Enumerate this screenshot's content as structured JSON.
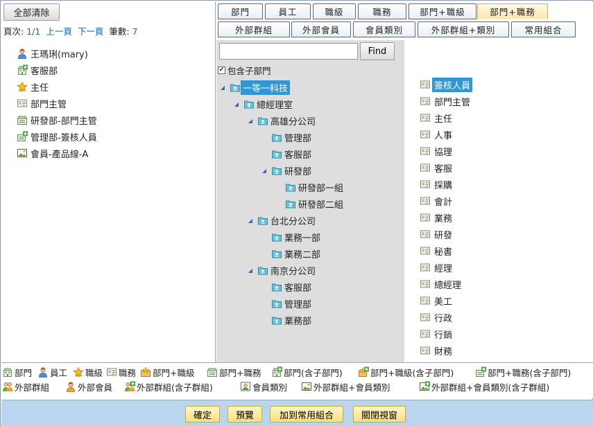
{
  "left": {
    "clear_label": "全部清除",
    "pager": {
      "page_label": "頁次:",
      "page_value": "1/1",
      "prev": "上一頁",
      "next": "下一頁",
      "count_label": "筆數:",
      "count_value": "7"
    },
    "selected": [
      {
        "label": "王瑪琍(mary)",
        "icon": "person-icon"
      },
      {
        "label": "客服部",
        "icon": "department-sub-icon"
      },
      {
        "label": "主任",
        "icon": "job-level-icon"
      },
      {
        "label": "部門主管",
        "icon": "job-title-icon"
      },
      {
        "label": "研發部-部門主管",
        "icon": "dept-job-title-icon"
      },
      {
        "label": "管理部-簽核人員",
        "icon": "dept-job-title-sub-icon"
      },
      {
        "label": "會員-產品線-A",
        "icon": "member-group-icon"
      }
    ]
  },
  "tabs": {
    "row1": [
      "部門",
      "員工",
      "職級",
      "職務",
      "部門+職級",
      "部門+職務"
    ],
    "row2": [
      "外部群組",
      "外部會員",
      "會員類別",
      "外部群組+類別",
      "常用組合"
    ],
    "active": "部門+職務"
  },
  "search": {
    "value": "",
    "placeholder": "",
    "find_label": "Find",
    "include_sub_label": "包含子部門",
    "include_sub_checked": true
  },
  "tree": [
    {
      "label": "一等一科技",
      "depth": 0,
      "toggle": "expanded",
      "selected": true
    },
    {
      "label": "總經理室",
      "depth": 1,
      "toggle": "expanded"
    },
    {
      "label": "高雄分公司",
      "depth": 2,
      "toggle": "expanded"
    },
    {
      "label": "管理部",
      "depth": 3,
      "toggle": "none"
    },
    {
      "label": "客服部",
      "depth": 3,
      "toggle": "none"
    },
    {
      "label": "研發部",
      "depth": 3,
      "toggle": "expanded"
    },
    {
      "label": "研發部一組",
      "depth": 4,
      "toggle": "none"
    },
    {
      "label": "研發部二組",
      "depth": 4,
      "toggle": "none"
    },
    {
      "label": "台北分公司",
      "depth": 2,
      "toggle": "expanded"
    },
    {
      "label": "業務一部",
      "depth": 3,
      "toggle": "none"
    },
    {
      "label": "業務二部",
      "depth": 3,
      "toggle": "none"
    },
    {
      "label": "南京分公司",
      "depth": 2,
      "toggle": "expanded"
    },
    {
      "label": "客服部",
      "depth": 3,
      "toggle": "none"
    },
    {
      "label": "管理部",
      "depth": 3,
      "toggle": "none"
    },
    {
      "label": "業務部",
      "depth": 3,
      "toggle": "none"
    }
  ],
  "jobs": [
    {
      "label": "簽核人員",
      "selected": true
    },
    {
      "label": "部門主管"
    },
    {
      "label": "主任"
    },
    {
      "label": "人事"
    },
    {
      "label": "協理"
    },
    {
      "label": "客服"
    },
    {
      "label": "採購"
    },
    {
      "label": "會計"
    },
    {
      "label": "業務"
    },
    {
      "label": "研發"
    },
    {
      "label": "秘書"
    },
    {
      "label": "經理"
    },
    {
      "label": "總經理"
    },
    {
      "label": "美工"
    },
    {
      "label": "行政"
    },
    {
      "label": "行銷"
    },
    {
      "label": "財務"
    }
  ],
  "legend": {
    "row1": [
      {
        "label": "部門",
        "icon": "department-icon"
      },
      {
        "label": "員工",
        "icon": "person-icon"
      },
      {
        "label": "職級",
        "icon": "job-level-icon"
      },
      {
        "label": "職務",
        "icon": "job-title-icon"
      },
      {
        "label": "部門+職級",
        "icon": "dept-job-level-icon"
      },
      {
        "label": "部門+職務",
        "icon": "dept-job-title-icon"
      },
      {
        "label": "部門(含子部門)",
        "icon": "department-sub-icon"
      },
      {
        "label": "部門+職級(含子部門)",
        "icon": "dept-job-level-sub-icon"
      },
      {
        "label": "部門+職務(含子部門)",
        "icon": "dept-job-title-sub-icon"
      }
    ],
    "row2": [
      {
        "label": "外部群組",
        "icon": "external-group-icon"
      },
      {
        "label": "外部會員",
        "icon": "external-member-icon"
      },
      {
        "label": "外部群組(含子群組)",
        "icon": "external-group-sub-icon"
      },
      {
        "label": "會員類別",
        "icon": "member-type-icon"
      },
      {
        "label": "外部群組+會員類別",
        "icon": "member-group-icon"
      },
      {
        "label": "外部群組+會員類別(含子群組)",
        "icon": "member-group-sub-icon"
      }
    ]
  },
  "footer": {
    "confirm": "確定",
    "preview": "預覽",
    "add_common": "加到常用組合",
    "close": "關閉視窗"
  }
}
